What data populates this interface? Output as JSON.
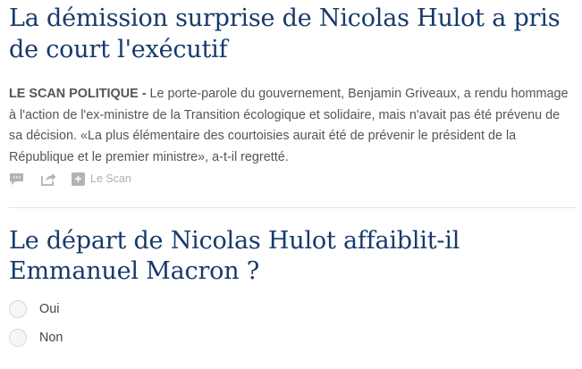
{
  "article": {
    "headline": "La démission surprise de Nicolas Hulot a pris de court l'exécutif",
    "rubric": "LE SCAN POLITIQUE - ",
    "summary": "Le porte-parole du gouvernement, Benjamin Griveaux, a rendu hommage à l'action de l'ex-ministre de la Transition écologique et solidaire, mais n'avait pas été prévenu de sa décision. «La plus élémentaire des courtoisies aurait été de prévenir le président de la République et le premier ministre», a-t-il regretté.",
    "actions": {
      "comment_icon": "comment-icon",
      "share_icon": "share-icon",
      "tag_icon": "plus-icon",
      "tag_label": "Le Scan"
    }
  },
  "poll": {
    "question": "Le départ de Nicolas Hulot affaiblit-il Emmanuel Macron ?",
    "options": [
      {
        "label": "Oui"
      },
      {
        "label": "Non"
      }
    ]
  },
  "colors": {
    "headline": "#163a6b",
    "body_text": "#555555",
    "muted": "#b0b0b0",
    "divider": "#e2e2e2"
  }
}
